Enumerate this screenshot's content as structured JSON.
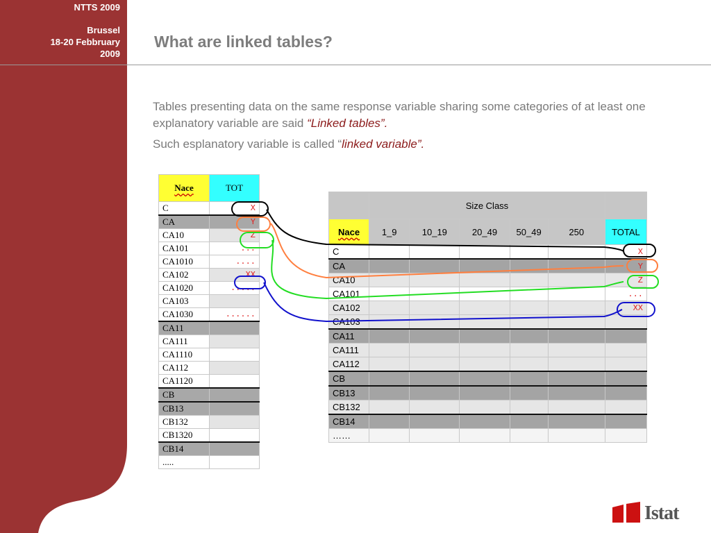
{
  "sidebar": {
    "event": "NTTS  2009",
    "city": "Brussel",
    "dates": "18-20 Febbruary",
    "year": "2009",
    "bg_color": "#9b3333"
  },
  "slide": {
    "title": "What are linked tables?",
    "para1_pre": "Tables presenting data on the same response variable sharing some categories of at least one explanatory variable are said ",
    "para1_em": "“Linked tables”.",
    "para2_pre": "Such esplanatory variable is called “",
    "para2_em": "linked variable”."
  },
  "table1": {
    "headers": [
      "Nace",
      "TOT"
    ],
    "rows": [
      {
        "code": "C",
        "value": "X",
        "style": "white"
      },
      {
        "code": "CA",
        "value": "Y",
        "style": "dark"
      },
      {
        "code": "CA10",
        "value": "Z",
        "style": "lite"
      },
      {
        "code": "CA101",
        "value": "...",
        "style": "white"
      },
      {
        "code": "CA1010",
        "value": "....",
        "style": "white"
      },
      {
        "code": "CA102",
        "value": "XX",
        "style": "lite"
      },
      {
        "code": "CA1020",
        "value": ".....",
        "style": "white"
      },
      {
        "code": "CA103",
        "value": "",
        "style": "lite"
      },
      {
        "code": "CA1030",
        "value": "......",
        "style": "white"
      },
      {
        "code": "CA11",
        "value": "",
        "style": "dark"
      },
      {
        "code": "CA111",
        "value": "",
        "style": "lite"
      },
      {
        "code": "CA1110",
        "value": "",
        "style": "white"
      },
      {
        "code": "CA112",
        "value": "",
        "style": "lite"
      },
      {
        "code": "CA1120",
        "value": "",
        "style": "white"
      },
      {
        "code": "CB",
        "value": "",
        "style": "dark"
      },
      {
        "code": "CB13",
        "value": "",
        "style": "dark"
      },
      {
        "code": "CB132",
        "value": "",
        "style": "lite"
      },
      {
        "code": "CB1320",
        "value": "",
        "style": "white"
      },
      {
        "code": "CB14",
        "value": "",
        "style": "dark"
      },
      {
        "code": ".....",
        "value": "",
        "style": "white"
      }
    ]
  },
  "table2": {
    "group_header": "Size Class",
    "headers": [
      "Nace",
      "1_9",
      "10_19",
      "20_49",
      "50_49",
      "250",
      "TOTAL"
    ],
    "rows": [
      {
        "code": "C",
        "total": "X",
        "style": "white"
      },
      {
        "code": "CA",
        "total": "Y",
        "style": "dark"
      },
      {
        "code": "CA10",
        "total": "Z",
        "style": "lite"
      },
      {
        "code": "CA101",
        "total": "...",
        "style": "white"
      },
      {
        "code": "CA102",
        "total": "XX",
        "style": "lite"
      },
      {
        "code": "CA103",
        "total": "",
        "style": "lite"
      },
      {
        "code": "CA11",
        "total": "",
        "style": "dark"
      },
      {
        "code": "CA111",
        "total": "",
        "style": "lite"
      },
      {
        "code": "CA112",
        "total": "",
        "style": "lite"
      },
      {
        "code": "CB",
        "total": "",
        "style": "dark"
      },
      {
        "code": "CB13",
        "total": "",
        "style": "dark"
      },
      {
        "code": "CB132",
        "total": "",
        "style": "lite"
      },
      {
        "code": "CB14",
        "total": "",
        "style": "dark"
      },
      {
        "code": "……",
        "total": "",
        "style": "sum"
      }
    ]
  },
  "links": [
    {
      "name": "X",
      "color": "#000000"
    },
    {
      "name": "Y",
      "color": "#ff7f3f"
    },
    {
      "name": "Z",
      "color": "#22dd22"
    },
    {
      "name": "XX",
      "color": "#1111cc"
    }
  ],
  "logo": {
    "text": "Istat",
    "color": "#cc1111"
  }
}
